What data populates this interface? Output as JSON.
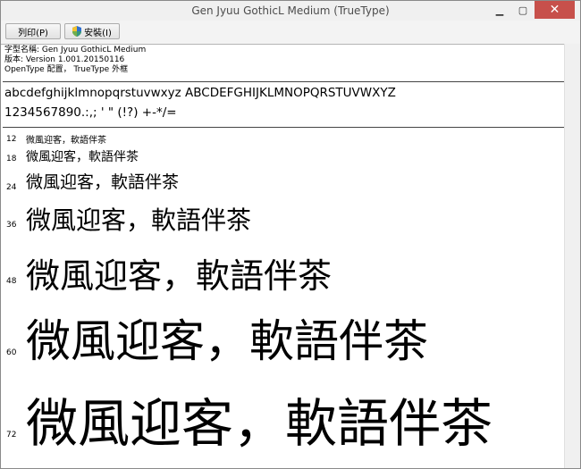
{
  "window": {
    "title": "Gen Jyuu GothicL Medium (TrueType)",
    "close_label": "✕"
  },
  "toolbar": {
    "print_label": "列印(P)",
    "install_label": "安裝(I)"
  },
  "info": {
    "font_name": "字型名稱: Gen Jyuu GothicL Medium",
    "version": "版本: Version 1.001.20150116",
    "type": "OpenType 配置， TrueType 外框"
  },
  "samples": {
    "alphabet": "abcdefghijklmnopqrstuvwxyz ABCDEFGHIJKLMNOPQRSTUVWXYZ",
    "digits": "1234567890.:,; ' \" (!?) +-*/="
  },
  "preview_text": "微風迎客，軟語伴茶",
  "sizes": [
    {
      "label": "12",
      "size": 12
    },
    {
      "label": "18",
      "size": 18
    },
    {
      "label": "24",
      "size": 24
    },
    {
      "label": "36",
      "size": 36
    },
    {
      "label": "48",
      "size": 48
    },
    {
      "label": "60",
      "size": 60
    },
    {
      "label": "72",
      "size": 72
    }
  ]
}
